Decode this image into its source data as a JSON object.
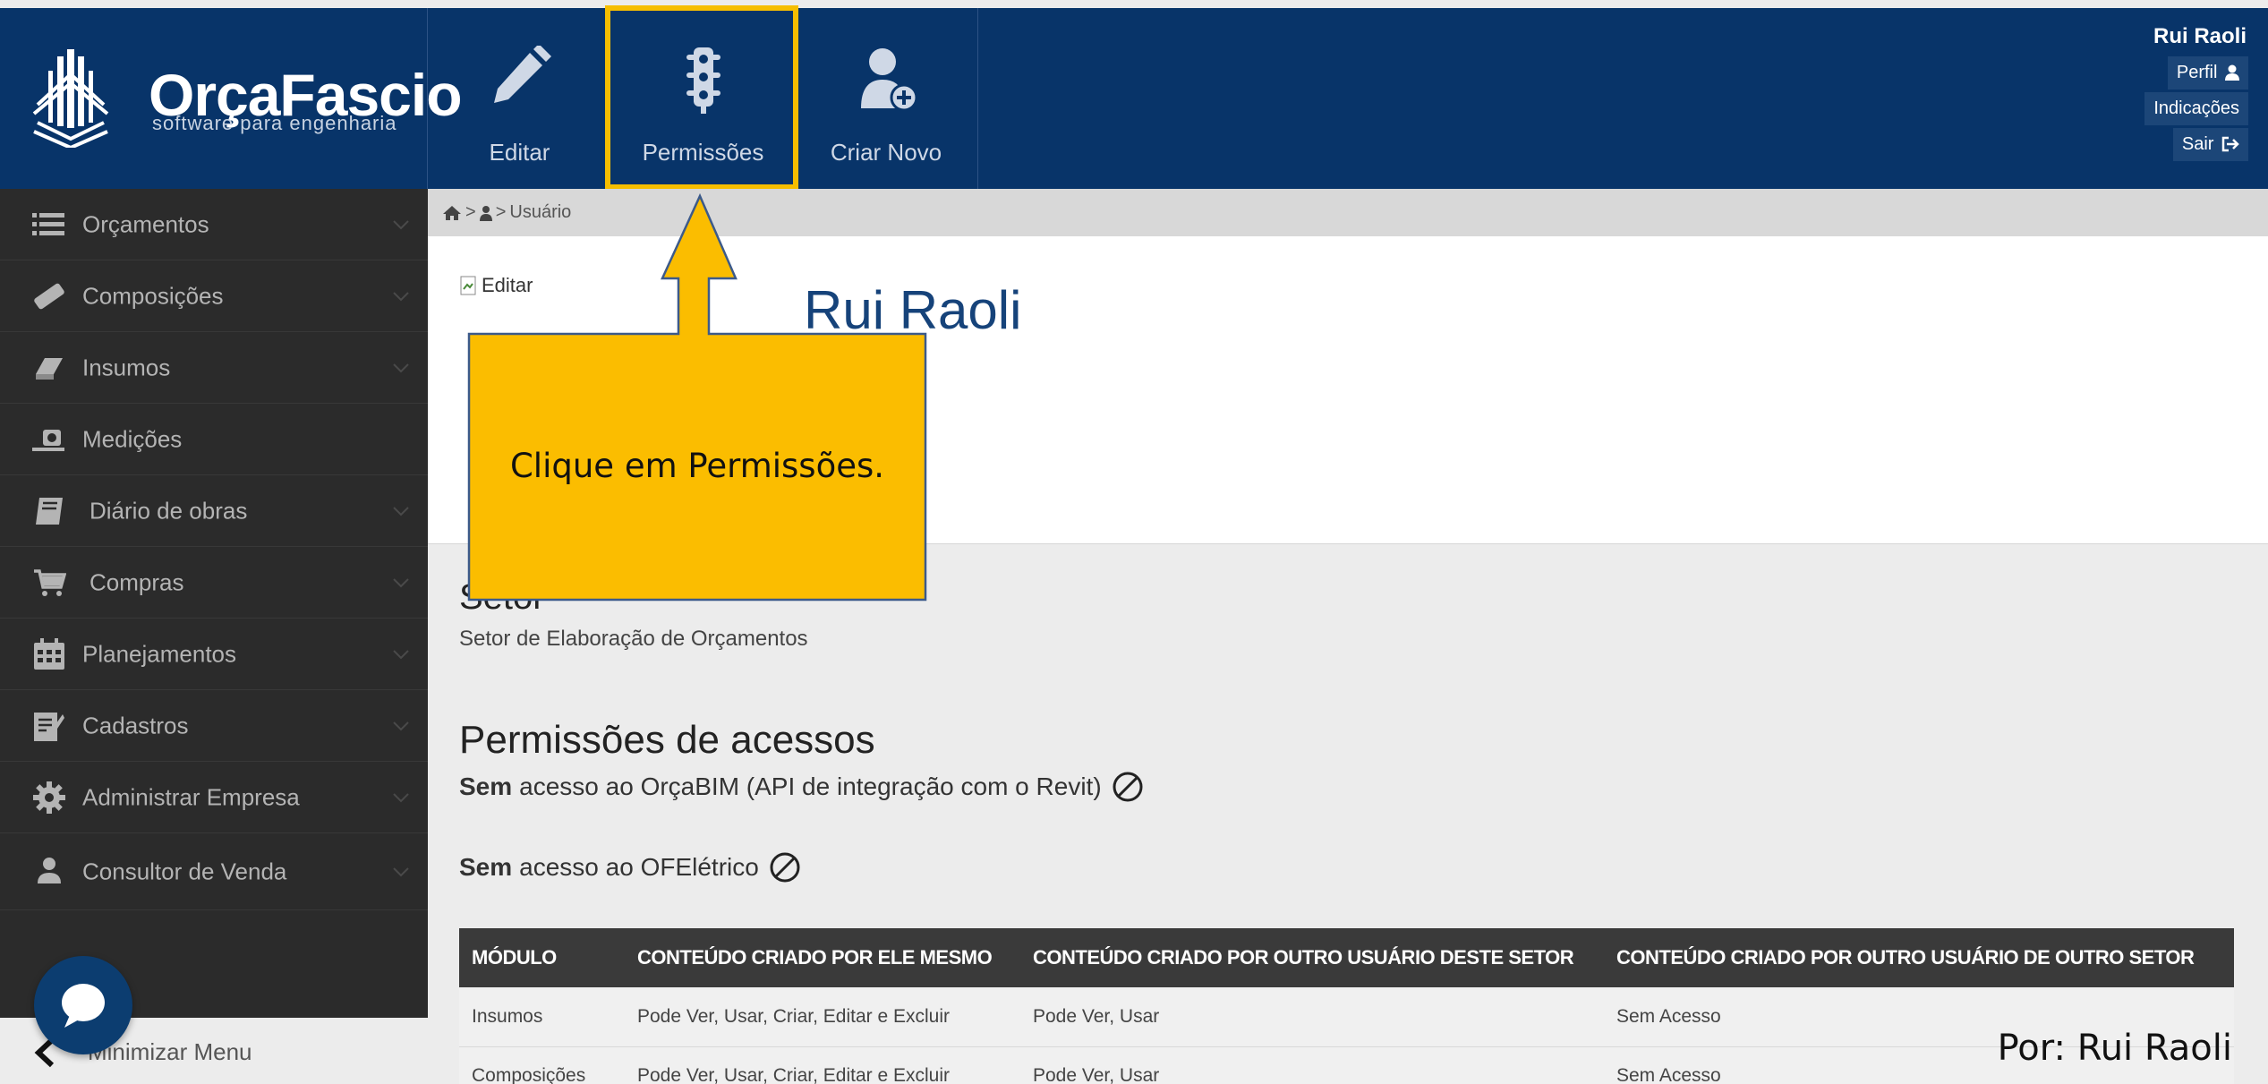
{
  "header": {
    "brand": "OrçaFascio",
    "tagline": "software para engenharia",
    "tools": [
      {
        "label": "Editar",
        "icon": "pencil-icon"
      },
      {
        "label": "Permissões",
        "icon": "traffic-light-icon"
      },
      {
        "label": "Criar Novo",
        "icon": "user-plus-icon"
      }
    ],
    "user": {
      "name": "Rui Raoli",
      "links": [
        "Perfil",
        "Indicações",
        "Sair"
      ]
    },
    "colors": {
      "background": "#083469",
      "highlight": "#f6be00"
    }
  },
  "sidebar": {
    "items": [
      {
        "label": "Orçamentos",
        "icon": "list-icon"
      },
      {
        "label": "Composições",
        "icon": "eraser-icon"
      },
      {
        "label": "Insumos",
        "icon": "block-icon"
      },
      {
        "label": "Medições",
        "icon": "measure-icon"
      },
      {
        "label": "Diário de obras",
        "icon": "book-icon"
      },
      {
        "label": "Compras",
        "icon": "cart-icon"
      },
      {
        "label": "Planejamentos",
        "icon": "calendar-icon"
      },
      {
        "label": "Cadastros",
        "icon": "clipboard-icon"
      },
      {
        "label": "Administrar Empresa",
        "icon": "gear-icon"
      },
      {
        "label": "Consultor de Venda",
        "icon": "user-icon"
      }
    ],
    "minimize_label": "Minimizar Menu"
  },
  "breadcrumb": {
    "current": "Usuário"
  },
  "profile": {
    "image_alt": "Editar",
    "name": "Rui Raoli"
  },
  "setor": {
    "title": "Setor",
    "value": "Setor de Elaboração de Orçamentos"
  },
  "permissions": {
    "title": "Permissões de acessos",
    "access_lines": [
      {
        "bold": "Sem",
        "text": "acesso ao OrçaBIM (API de integração com o Revit)"
      },
      {
        "bold": "Sem",
        "text": "acesso ao OFElétrico"
      }
    ],
    "table": {
      "headers": [
        "MÓDULO",
        "CONTEÚDO CRIADO POR ELE MESMO",
        "CONTEÚDO CRIADO POR OUTRO USUÁRIO DESTE SETOR",
        "CONTEÚDO CRIADO POR OUTRO USUÁRIO DE OUTRO SETOR"
      ],
      "rows": [
        [
          "Insumos",
          "Pode Ver, Usar, Criar, Editar e Excluir",
          "Pode Ver, Usar",
          "Sem Acesso"
        ],
        [
          "Composições",
          "Pode Ver, Usar, Criar, Editar e Excluir",
          "Pode Ver, Usar",
          "Sem Acesso"
        ]
      ]
    }
  },
  "annotation": {
    "callout_text": "Clique em Permissões.",
    "watermark": "Por: Rui Raoli",
    "callout_color": "#fbbd00"
  }
}
